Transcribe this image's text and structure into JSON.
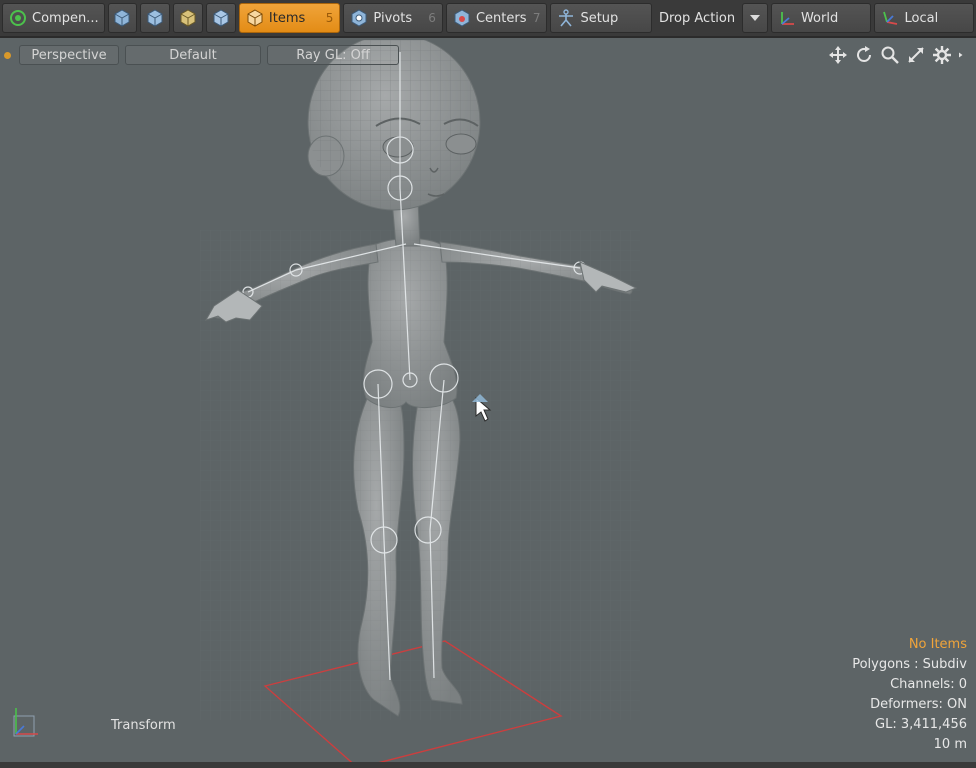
{
  "toolbar": {
    "compenent_label": "Compen...",
    "items_label": "Items",
    "items_key": "5",
    "pivots_label": "Pivots",
    "pivots_key": "6",
    "centers_label": "Centers",
    "centers_key": "7",
    "setup_label": "Setup",
    "drop_action_label": "Drop Action",
    "world_label": "World",
    "local_label": "Local"
  },
  "viewport": {
    "projection": "Perspective",
    "style": "Default",
    "raygl": "Ray GL: Off"
  },
  "overlay": {
    "tool_name": "Transform",
    "selection": "No Items",
    "polygons": "Polygons : Subdiv",
    "channels": "Channels: 0",
    "deformers": "Deformers: ON",
    "gl_count": "GL: 3,411,456",
    "grid_scale": "10 m"
  },
  "colors": {
    "accent": "#f0a43a",
    "viewport_bg": "#5d6466",
    "toolbar_bg": "#3a3a3a",
    "floor_marker": "#d83a3a"
  }
}
